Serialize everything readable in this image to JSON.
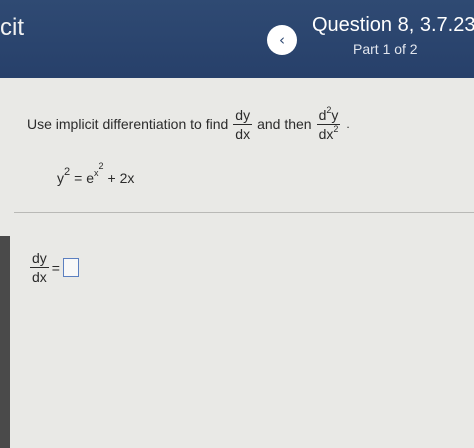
{
  "header": {
    "brand": "cit",
    "back_icon": "chevron-left-icon",
    "back_glyph": "‹",
    "question_title": "Question 8, 3.7.23",
    "part_label": "Part 1 of 2",
    "colors": {
      "bar": "#2f4a73",
      "back_button": "#ffffff"
    }
  },
  "prompt": {
    "lead_text": "Use implicit differentiation to find",
    "frac1_num": "dy",
    "frac1_den": "dx",
    "connector": "and then",
    "frac2_num_d": "d",
    "frac2_num_exp": "2",
    "frac2_num_y": "y",
    "frac2_den_dx": "dx",
    "frac2_den_exp": "2",
    "end_punct": "."
  },
  "equation": {
    "lhs_base": "y",
    "lhs_exp": "2",
    "equals_e": "= e",
    "exp_base": "x",
    "exp_power": "2",
    "tail": "+ 2x"
  },
  "answer": {
    "num": "dy",
    "den": "dx",
    "equals": "=",
    "value": ""
  }
}
